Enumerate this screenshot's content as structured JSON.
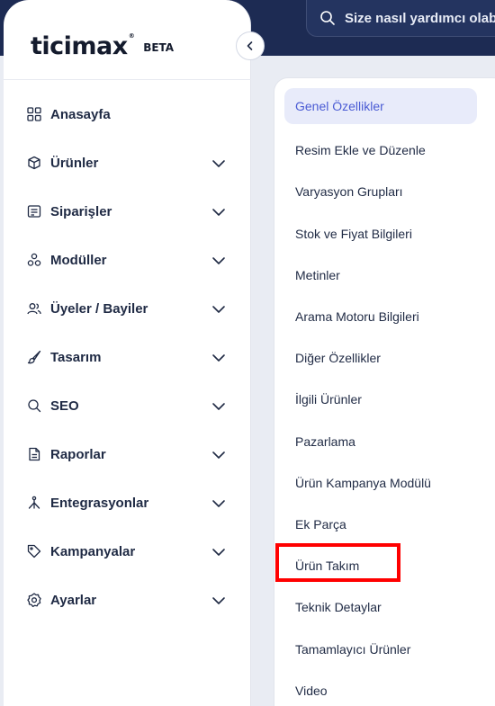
{
  "search": {
    "placeholder": "Size nasıl yardımcı olabilir"
  },
  "logo": {
    "brand": "ticimax",
    "reg": "®",
    "tag": "BETA"
  },
  "sidebar": {
    "items": [
      {
        "label": "Anasayfa",
        "icon": "grid-icon"
      },
      {
        "label": "Ürünler",
        "icon": "box-icon"
      },
      {
        "label": "Siparişler",
        "icon": "receipt-icon"
      },
      {
        "label": "Modüller",
        "icon": "modules-icon"
      },
      {
        "label": "Üyeler / Bayiler",
        "icon": "users-icon"
      },
      {
        "label": "Tasarım",
        "icon": "brush-icon"
      },
      {
        "label": "SEO",
        "icon": "search-icon"
      },
      {
        "label": "Raporlar",
        "icon": "document-icon"
      },
      {
        "label": "Entegrasyonlar",
        "icon": "integration-icon"
      },
      {
        "label": "Kampanyalar",
        "icon": "tag-icon"
      },
      {
        "label": "Ayarlar",
        "icon": "settings-icon"
      }
    ]
  },
  "submenu": {
    "items": [
      "Genel Özellikler",
      "Resim Ekle ve Düzenle",
      "Varyasyon Grupları",
      "Stok ve Fiyat Bilgileri",
      "Metinler",
      "Arama Motoru Bilgileri",
      "Diğer Özellikler",
      "İlgili Ürünler",
      "Pazarlama",
      "Ürün Kampanya Modülü",
      "Ek Parça",
      "Ürün Takım",
      "Teknik Detaylar",
      "Tamamlayıcı Ürünler",
      "Video"
    ],
    "active_index": 0,
    "highlighted_item": "Ürün Takım"
  },
  "colors": {
    "topbar": "#1d2b53",
    "active_bg": "#e8ebfa",
    "active_text": "#4a5bd4",
    "highlight": "#ff0000"
  }
}
